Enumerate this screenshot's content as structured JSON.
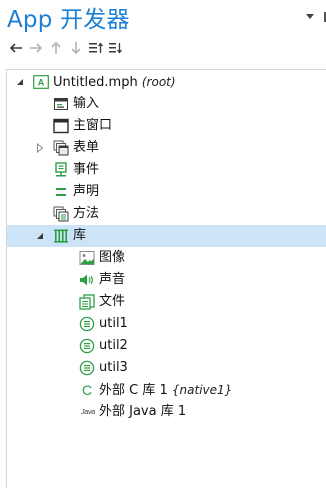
{
  "header": {
    "title": "App 开发器"
  },
  "toolbar": {
    "buttons": [
      {
        "name": "back",
        "icon": "arrow-left-icon",
        "enabled": true
      },
      {
        "name": "forward",
        "icon": "arrow-right-icon",
        "enabled": false
      },
      {
        "name": "up",
        "icon": "arrow-up-icon",
        "enabled": false
      },
      {
        "name": "down",
        "icon": "arrow-down-icon",
        "enabled": false
      },
      {
        "name": "expand-sections",
        "icon": "expand-sections-icon",
        "enabled": true
      },
      {
        "name": "show-more",
        "icon": "show-more-options-icon",
        "enabled": true
      }
    ]
  },
  "tree": {
    "root": {
      "label": "Untitled.mph",
      "tag": "(root)",
      "icon": "app-root-icon"
    },
    "nodes": [
      {
        "label": "输入",
        "icon": "input-icon"
      },
      {
        "label": "主窗口",
        "icon": "main-window-icon"
      },
      {
        "label": "表单",
        "icon": "forms-icon"
      },
      {
        "label": "事件",
        "icon": "events-icon"
      },
      {
        "label": "声明",
        "icon": "declarations-icon"
      },
      {
        "label": "方法",
        "icon": "methods-icon"
      },
      {
        "label": "库",
        "icon": "libraries-icon"
      },
      {
        "label": "图像",
        "icon": "images-icon"
      },
      {
        "label": "声音",
        "icon": "sounds-icon"
      },
      {
        "label": "文件",
        "icon": "files-icon"
      },
      {
        "label": "util1",
        "icon": "utility-class-icon"
      },
      {
        "label": "util2",
        "icon": "utility-class-icon"
      },
      {
        "label": "util3",
        "icon": "utility-class-icon"
      },
      {
        "label": "外部 C 库 1",
        "tag": "{native1}",
        "icon": "external-c-library-icon"
      },
      {
        "label": "外部 Java 库 1",
        "icon": "external-java-library-icon",
        "icon_text": "Java"
      }
    ]
  },
  "colors": {
    "title": "#1c7fd4",
    "selection": "#cce4f7",
    "accent_green": "#2e9e44",
    "border": "#d6d6d6"
  }
}
